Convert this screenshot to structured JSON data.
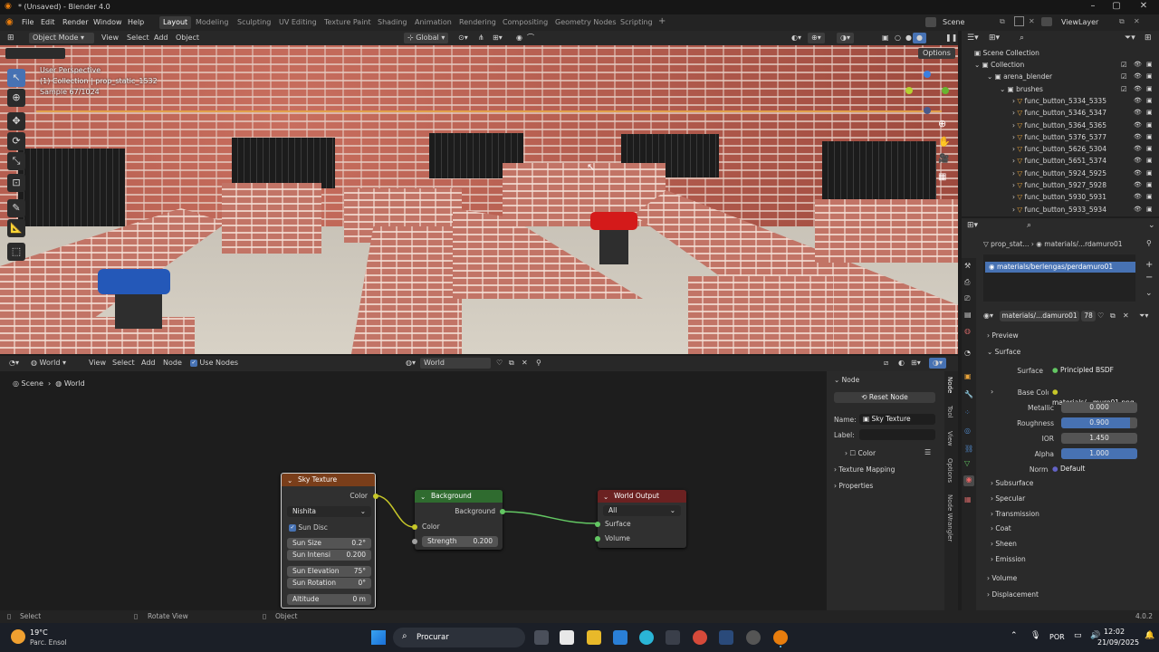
{
  "window": {
    "title": "* (Unsaved) - Blender 4.0"
  },
  "menu": {
    "items": [
      "File",
      "Edit",
      "Render",
      "Window",
      "Help"
    ]
  },
  "workspaces": {
    "tabs": [
      "Layout",
      "Modeling",
      "Sculpting",
      "UV Editing",
      "Texture Paint",
      "Shading",
      "Animation",
      "Rendering",
      "Compositing",
      "Geometry Nodes",
      "Scripting"
    ],
    "active": "Layout"
  },
  "topright": {
    "scene": "Scene",
    "viewlayer": "ViewLayer"
  },
  "viewport": {
    "mode": "Object Mode",
    "menus": [
      "View",
      "Select",
      "Add",
      "Object"
    ],
    "transform": "Global",
    "options": "Options",
    "overlay": [
      "User Perspective",
      "(1) Collection | prop_static_1532",
      "Sample 67/1024"
    ]
  },
  "node_editor": {
    "type": "World",
    "menus": [
      "View",
      "Select",
      "Add",
      "Node"
    ],
    "use_nodes": "Use Nodes",
    "world_name": "World",
    "breadcrumb": [
      "Scene",
      "World"
    ],
    "sky": {
      "title": "Sky Texture",
      "out": "Color",
      "type": "Nishita",
      "sun_disc": "Sun Disc",
      "sun_size_l": "Sun Size",
      "sun_size_v": "0.2°",
      "sun_int_l": "Sun Intensi",
      "sun_int_v": "0.200",
      "sun_elev_l": "Sun Elevation",
      "sun_elev_v": "75°",
      "sun_rot_l": "Sun Rotation",
      "sun_rot_v": "0°",
      "alt_l": "Altitude",
      "alt_v": "0 m"
    },
    "bg": {
      "title": "Background",
      "out": "Background",
      "color": "Color",
      "strength_l": "Strength",
      "strength_v": "0.200"
    },
    "wo": {
      "title": "World Output",
      "target": "All",
      "surface": "Surface",
      "volume": "Volume"
    }
  },
  "npanel": {
    "section": "Node",
    "reset": "Reset Node",
    "name_l": "Name:",
    "name_v": "Sky Texture",
    "label_l": "Label:",
    "color": "Color",
    "tex_map": "Texture Mapping",
    "properties": "Properties",
    "tabs": [
      "Node",
      "Tool",
      "View",
      "Options",
      "Node Wrangler"
    ]
  },
  "outliner": {
    "root": "Scene Collection",
    "rows": [
      "Collection",
      "arena_blender",
      "brushes",
      "func_button_5334_5335",
      "func_button_5346_5347",
      "func_button_5364_5365",
      "func_button_5376_5377",
      "func_button_5626_5304",
      "func_button_5651_5374",
      "func_button_5924_5925",
      "func_button_5927_5928",
      "func_button_5930_5931",
      "func_button_5933_5934"
    ]
  },
  "properties": {
    "breadcrumb_obj": "prop_stat...",
    "breadcrumb_mat": "materials/...rdamuro01",
    "slot": "materials/berlengas/perdamuro01",
    "mat_field": "materials/...damuro01",
    "users": "78",
    "preview": "Preview",
    "surface_hdr": "Surface",
    "surface_l": "Surface",
    "surface_v": "Principled BSDF",
    "base_color_l": "Base Color",
    "base_color_v": "materials/...muro01.png",
    "metallic_l": "Metallic",
    "metallic_v": "0.000",
    "roughness_l": "Roughness",
    "roughness_v": "0.900",
    "roughness_frac": 0.9,
    "ior_l": "IOR",
    "ior_v": "1.450",
    "alpha_l": "Alpha",
    "alpha_v": "1.000",
    "alpha_frac": 1.0,
    "normal_l": "Normal",
    "normal_v": "Default",
    "subsections": [
      "Subsurface",
      "Specular",
      "Transmission",
      "Coat",
      "Sheen",
      "Emission"
    ],
    "volume": "Volume",
    "displacement": "Displacement"
  },
  "status": {
    "select": "Select",
    "rotate": "Rotate View",
    "object": "Object",
    "version": "4.0.2"
  },
  "taskbar": {
    "temp": "19°C",
    "weather": "Parc. Ensol",
    "search": "Procurar",
    "lang": "POR",
    "time": "12:02",
    "date": "21/09/2025"
  },
  "colors": {
    "sky_header": "#7a3e1a",
    "bg_header": "#2f6b2f",
    "out_header": "#6b2121",
    "accent": "#4772b3",
    "socket_green": "#63c763",
    "socket_yellow": "#c7c729",
    "socket_gray": "#a1a1a1"
  }
}
